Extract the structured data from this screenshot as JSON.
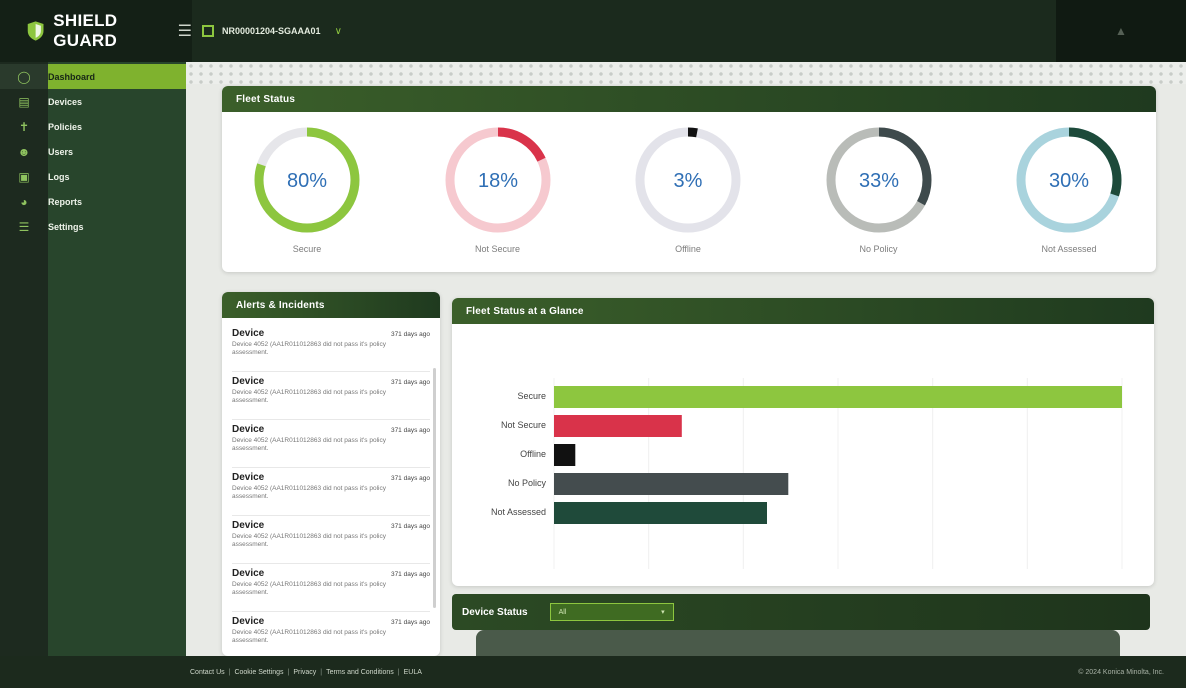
{
  "header": {
    "brand": "SHIELD GUARD",
    "tenant": "NR00001204-SGAAA01"
  },
  "sidebar": {
    "items": [
      {
        "label": "Dashboard",
        "icon": "dashboard-icon"
      },
      {
        "label": "Devices",
        "icon": "devices-icon"
      },
      {
        "label": "Policies",
        "icon": "policies-icon"
      },
      {
        "label": "Users",
        "icon": "users-icon"
      },
      {
        "label": "Logs",
        "icon": "logs-icon"
      },
      {
        "label": "Reports",
        "icon": "reports-icon"
      },
      {
        "label": "Settings",
        "icon": "settings-icon"
      }
    ]
  },
  "fleet_status": {
    "title": "Fleet Status",
    "gauges": [
      {
        "label": "Secure",
        "value": 80,
        "display": "80%",
        "color": "#8dc63f"
      },
      {
        "label": "Not Secure",
        "value": 18,
        "display": "18%",
        "color": "#d9334a"
      },
      {
        "label": "Offline",
        "value": 3,
        "display": "3%",
        "color": "#111111"
      },
      {
        "label": "No Policy",
        "value": 33,
        "display": "33%",
        "color": "#3e4a4c"
      },
      {
        "label": "Not Assessed",
        "value": 30,
        "display": "30%",
        "color": "#1d4a3a"
      }
    ]
  },
  "alerts": {
    "title": "Alerts & Incidents",
    "items": [
      {
        "title": "Device",
        "time": "371 days ago",
        "desc": "Device 4052 (AA1R011012863 did not pass it's policy assessment."
      },
      {
        "title": "Device",
        "time": "371 days ago",
        "desc": "Device 4052 (AA1R011012863 did not pass it's policy assessment."
      },
      {
        "title": "Device",
        "time": "371 days ago",
        "desc": "Device 4052 (AA1R011012863 did not pass it's policy assessment."
      },
      {
        "title": "Device",
        "time": "371 days ago",
        "desc": "Device 4052 (AA1R011012863 did not pass it's policy assessment."
      },
      {
        "title": "Device",
        "time": "371 days ago",
        "desc": "Device 4052 (AA1R011012863 did not pass it's policy assessment."
      },
      {
        "title": "Device",
        "time": "371 days ago",
        "desc": "Device 4052 (AA1R011012863 did not pass it's policy assessment."
      },
      {
        "title": "Device",
        "time": "371 days ago",
        "desc": "Device 4052 (AA1R011012863 did not pass it's policy assessment."
      }
    ]
  },
  "glance": {
    "title": "Fleet Status at a Glance"
  },
  "chart_data": {
    "type": "bar",
    "orientation": "horizontal",
    "categories": [
      "Secure",
      "Not Secure",
      "Offline",
      "No Policy",
      "Not Assessed"
    ],
    "values": [
      80,
      18,
      3,
      33,
      30
    ],
    "colors": [
      "#8dc63f",
      "#d9334a",
      "#111111",
      "#444c4e",
      "#1f4a3a"
    ],
    "grid": true
  },
  "device_status": {
    "title": "Device Status",
    "selected": "All"
  },
  "footer": {
    "links": [
      "Contact Us",
      "Cookie Settings",
      "Privacy",
      "Terms and Conditions",
      "EULA"
    ],
    "copyright": "© 2024 Konica Minolta, Inc."
  }
}
